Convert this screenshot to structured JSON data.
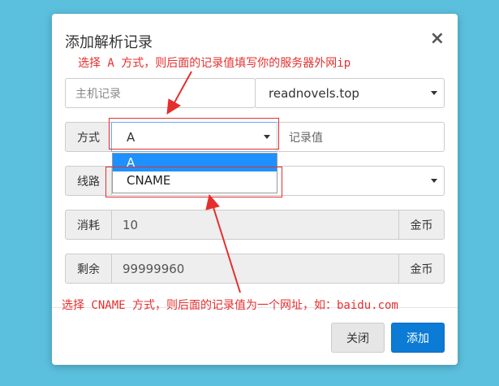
{
  "dialog": {
    "title": "添加解析记录",
    "close_icon": "×"
  },
  "annotations": {
    "top": "选择 A 方式，则后面的记录值填写你的服务器外网ip",
    "bottom": "选择 CNAME 方式，则后面的记录值为一个网址，如：baidu.com"
  },
  "host": {
    "placeholder": "主机记录",
    "domain_value": "readnovels.top"
  },
  "type_row": {
    "label": "方式",
    "selected": "A",
    "record_placeholder": "记录值",
    "options": [
      "A",
      "CNAME"
    ]
  },
  "line_row": {
    "label": "线路"
  },
  "cost_row": {
    "label": "消耗",
    "value": "10",
    "unit": "金币"
  },
  "balance_row": {
    "label": "剩余",
    "value": "99999960",
    "unit": "金币"
  },
  "buttons": {
    "close": "关闭",
    "add": "添加"
  },
  "colors": {
    "background": "#5bc0de",
    "primary": "#0b7bd6",
    "annotation": "#e52f2f",
    "selected_option": "#1e90ff"
  }
}
